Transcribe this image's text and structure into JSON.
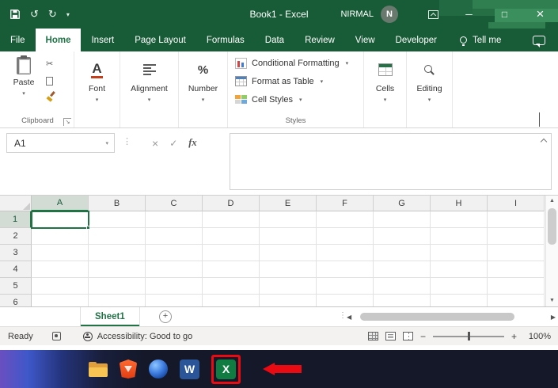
{
  "titlebar": {
    "title": "Book1 - Excel",
    "user": "NIRMAL",
    "avatar": "N"
  },
  "tabs": {
    "items": [
      {
        "label": "File"
      },
      {
        "label": "Home",
        "active": true
      },
      {
        "label": "Insert"
      },
      {
        "label": "Page Layout"
      },
      {
        "label": "Formulas"
      },
      {
        "label": "Data"
      },
      {
        "label": "Review"
      },
      {
        "label": "View"
      },
      {
        "label": "Developer"
      }
    ],
    "tell_me": "Tell me"
  },
  "ribbon": {
    "paste_label": "Paste",
    "font_label": "Font",
    "alignment_label": "Alignment",
    "number_label": "Number",
    "number_icon": "%",
    "conditional_formatting": "Conditional Formatting",
    "format_as_table": "Format as Table",
    "cell_styles": "Cell Styles",
    "cells_label": "Cells",
    "editing_label": "Editing",
    "clipboard_group": "Clipboard",
    "styles_group": "Styles"
  },
  "formula": {
    "name_box": "A1",
    "fx": "fx"
  },
  "grid": {
    "columns": [
      "A",
      "B",
      "C",
      "D",
      "E",
      "F",
      "G",
      "H",
      "I"
    ],
    "rows": [
      "1",
      "2",
      "3",
      "4",
      "5",
      "6"
    ],
    "selected_cell": "A1"
  },
  "sheets": {
    "active_tab": "Sheet1"
  },
  "status": {
    "mode": "Ready",
    "accessibility": "Accessibility: Good to go",
    "zoom_level": "100%"
  },
  "taskbar": {
    "word_letter": "W",
    "excel_letter": "X"
  },
  "colors": {
    "excel_green": "#185C37",
    "accent_green": "#217346",
    "highlight_red": "#EA0B12"
  },
  "icons": {
    "undo": "↺",
    "redo": "↻",
    "qat_dropdown": "▾",
    "minimize": "─",
    "maximize": "□",
    "close": "×",
    "dropdown": "▾",
    "cancel": "×",
    "enter": "✓",
    "scissors": "✂",
    "dots": "⋮",
    "dialog_launcher": "↘",
    "scroll_up": "▲",
    "scroll_down": "▼",
    "scroll_left": "◀",
    "scroll_right": "▶",
    "add_sheet": "+",
    "zoom_out": "−",
    "zoom_in": "+"
  }
}
